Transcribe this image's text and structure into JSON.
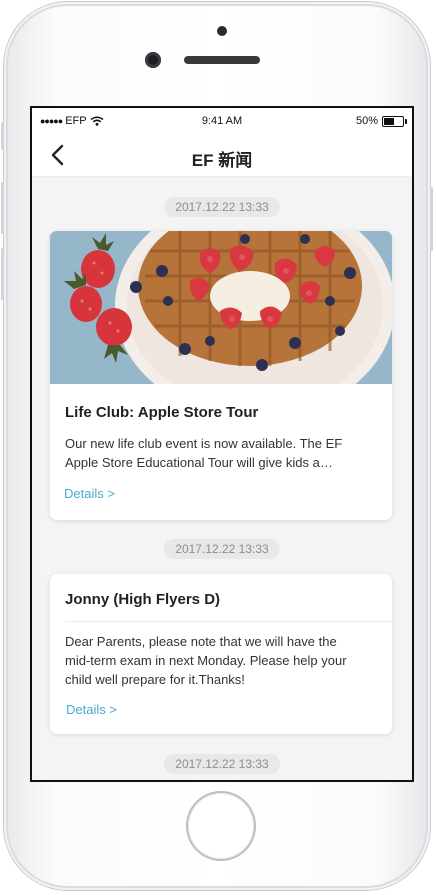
{
  "status_bar": {
    "carrier": "EFP",
    "time": "9:41 AM",
    "battery": "50%",
    "battery_level": 0.5
  },
  "nav": {
    "title": "EF 新闻",
    "back_icon": "chevron-left-icon"
  },
  "feed": [
    {
      "timestamp": "2017.12.22  13:33",
      "image": "waffle-with-strawberries-and-blueberries",
      "title": "Life Club: Apple Store Tour",
      "body_lines": [
        "Our new life club event is now available. The EF",
        "Apple Store Educational Tour will give kids a…"
      ],
      "details": "Details >"
    },
    {
      "timestamp": "2017.12.22  13:33",
      "title": "Jonny (High Flyers D)",
      "body_lines": [
        "Dear Parents, please note that we will have the",
        "mid-term exam in next Monday. Please help your",
        "child well prepare for it.Thanks!"
      ],
      "details": "Details >"
    },
    {
      "timestamp": "2017.12.22  13:33"
    }
  ],
  "colors": {
    "link": "#4aa9d2",
    "background": "#f4f4f5",
    "stamp_bg": "#e8e8ea"
  }
}
